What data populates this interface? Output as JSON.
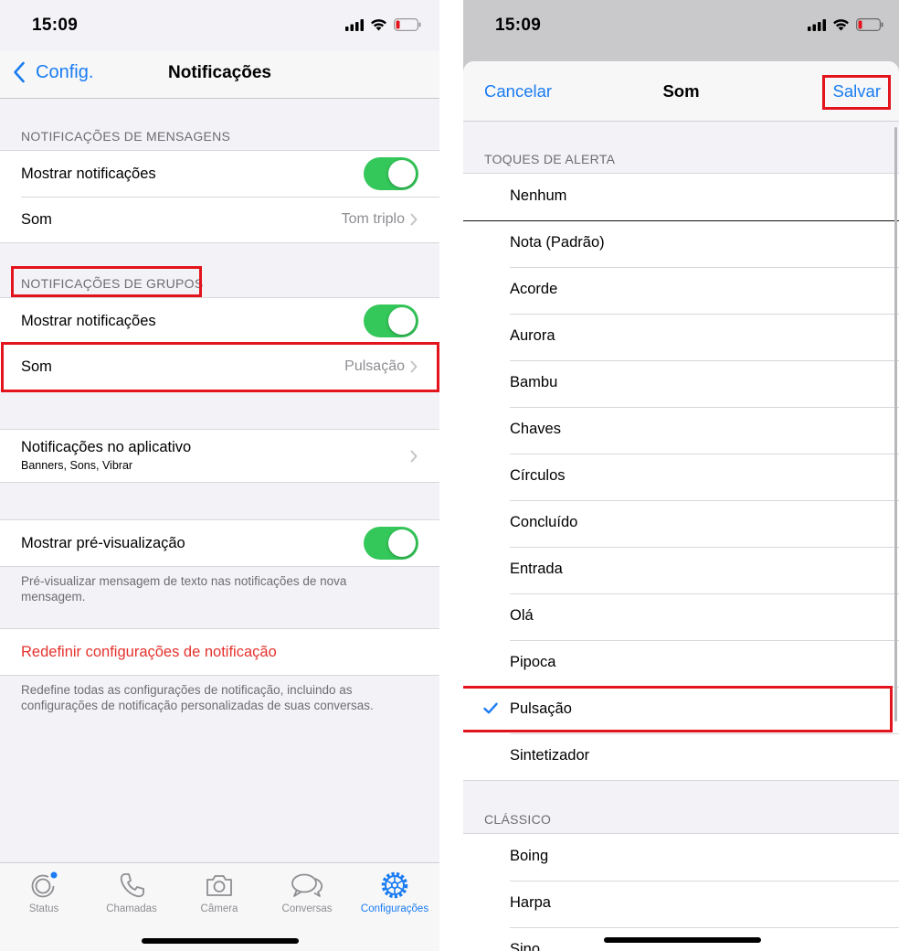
{
  "status": {
    "time": "15:09"
  },
  "left": {
    "nav": {
      "back_label": "Config.",
      "title": "Notificações"
    },
    "messages": {
      "header": "NOTIFICAÇÕES DE MENSAGENS",
      "show_label": "Mostrar notificações",
      "sound_label": "Som",
      "sound_value": "Tom triplo"
    },
    "groups": {
      "header": "NOTIFICAÇÕES DE GRUPOS",
      "show_label": "Mostrar notificações",
      "sound_label": "Som",
      "sound_value": "Pulsação"
    },
    "in_app": {
      "label": "Notificações no aplicativo",
      "sub": "Banners, Sons, Vibrar"
    },
    "preview": {
      "label": "Mostrar pré-visualização",
      "footer": "Pré-visualizar mensagem de texto nas notificações de nova mensagem."
    },
    "reset": {
      "label": "Redefinir configurações de notificação",
      "footer": "Redefine todas as configurações de notificação, incluindo as configurações de notificação personalizadas de suas conversas."
    },
    "tabs": [
      {
        "label": "Status",
        "icon": "status-icon"
      },
      {
        "label": "Chamadas",
        "icon": "phone-icon"
      },
      {
        "label": "Câmera",
        "icon": "camera-icon"
      },
      {
        "label": "Conversas",
        "icon": "chat-bubbles-icon"
      },
      {
        "label": "Configurações",
        "icon": "gear-icon"
      }
    ],
    "active_tab": "Configurações"
  },
  "right": {
    "sheet": {
      "cancel": "Cancelar",
      "title": "Som",
      "save": "Salvar"
    },
    "alert_header": "TOQUES DE ALERTA",
    "alert_tones": [
      "Nenhum",
      "Nota (Padrão)",
      "Acorde",
      "Aurora",
      "Bambu",
      "Chaves",
      "Círculos",
      "Concluído",
      "Entrada",
      "Olá",
      "Pipoca",
      "Pulsação",
      "Sintetizador"
    ],
    "selected_tone": "Pulsação",
    "classic_header": "CLÁSSICO",
    "classic_tones": [
      "Boing",
      "Harpa",
      "Sino"
    ]
  },
  "colors": {
    "accent": "#1a7cf2",
    "toggle_on": "#34c759",
    "destructive": "#e5322d",
    "highlight": "#e3141c"
  }
}
